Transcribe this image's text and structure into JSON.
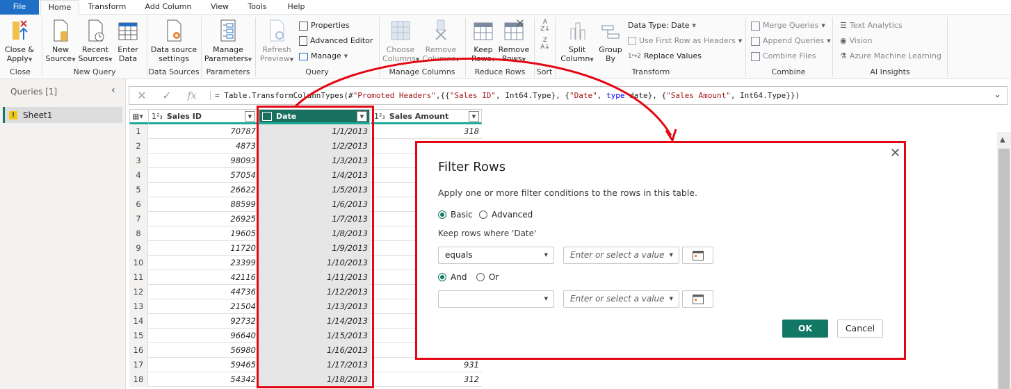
{
  "colors": {
    "accent": "#117865",
    "file_tab": "#1e6fc5",
    "highlight": "#e30613",
    "selected_header": "#1a7060"
  },
  "tabs": [
    "File",
    "Home",
    "Transform",
    "Add Column",
    "View",
    "Tools",
    "Help"
  ],
  "ribbon": {
    "close": {
      "close_apply": [
        "Close &",
        "Apply"
      ],
      "label": "Close"
    },
    "new_query": {
      "new_source": [
        "New",
        "Source"
      ],
      "recent_sources": [
        "Recent",
        "Sources"
      ],
      "enter_data": [
        "Enter",
        "Data"
      ],
      "label": "New Query"
    },
    "data_sources": {
      "settings": [
        "Data source",
        "settings"
      ],
      "label": "Data Sources"
    },
    "parameters": {
      "manage": [
        "Manage",
        "Parameters"
      ],
      "label": "Parameters"
    },
    "query": {
      "refresh": [
        "Refresh",
        "Preview"
      ],
      "properties": "Properties",
      "advanced_editor": "Advanced Editor",
      "manage": "Manage",
      "label": "Query"
    },
    "manage_columns": {
      "choose": [
        "Choose",
        "Columns"
      ],
      "remove": [
        "Remove",
        "Columns"
      ],
      "label": "Manage Columns"
    },
    "reduce_rows": {
      "keep": [
        "Keep",
        "Rows"
      ],
      "remove": [
        "Remove",
        "Rows"
      ],
      "label": "Reduce Rows"
    },
    "sort": {
      "label": "Sort"
    },
    "transform": {
      "split": [
        "Split",
        "Column"
      ],
      "group": [
        "Group",
        "By"
      ],
      "data_type": "Data Type: Date",
      "first_row": "Use First Row as Headers",
      "replace": "Replace Values",
      "label": "Transform"
    },
    "combine": {
      "merge": "Merge Queries",
      "append": "Append Queries",
      "files": "Combine Files",
      "label": "Combine"
    },
    "ai": {
      "text": "Text Analytics",
      "vision": "Vision",
      "azure": "Azure Machine Learning",
      "label": "AI Insights"
    }
  },
  "queries": {
    "title": "Queries [1]",
    "items": [
      {
        "name": "Sheet1",
        "warning": true
      }
    ]
  },
  "formula": {
    "prefix": "= Table.TransformColumnTypes(#",
    "s1": "\"Promoted Headers\"",
    "p2": ",{{",
    "s2": "\"Sales ID\"",
    "p3": ", Int64.Type}, {",
    "s3": "\"Date\"",
    "p4": ", ",
    "kw": "type",
    "p5": " date}, {",
    "s4": "\"Sales Amount\"",
    "p6": ", Int64.Type}})"
  },
  "table": {
    "columns": [
      {
        "name": "Sales ID",
        "type": "1²₃"
      },
      {
        "name": "Date",
        "type": "date"
      },
      {
        "name": "Sales Amount",
        "type": "1²₃"
      }
    ],
    "rows": [
      {
        "n": "1",
        "id": "70787",
        "date": "1/1/2013",
        "amount": "318"
      },
      {
        "n": "2",
        "id": "4873",
        "date": "1/2/2013",
        "amount": ""
      },
      {
        "n": "3",
        "id": "98093",
        "date": "1/3/2013",
        "amount": ""
      },
      {
        "n": "4",
        "id": "57054",
        "date": "1/4/2013",
        "amount": ""
      },
      {
        "n": "5",
        "id": "26622",
        "date": "1/5/2013",
        "amount": ""
      },
      {
        "n": "6",
        "id": "88599",
        "date": "1/6/2013",
        "amount": ""
      },
      {
        "n": "7",
        "id": "26925",
        "date": "1/7/2013",
        "amount": ""
      },
      {
        "n": "8",
        "id": "19605",
        "date": "1/8/2013",
        "amount": ""
      },
      {
        "n": "9",
        "id": "11720",
        "date": "1/9/2013",
        "amount": ""
      },
      {
        "n": "10",
        "id": "23399",
        "date": "1/10/2013",
        "amount": ""
      },
      {
        "n": "11",
        "id": "42116",
        "date": "1/11/2013",
        "amount": ""
      },
      {
        "n": "12",
        "id": "44736",
        "date": "1/12/2013",
        "amount": ""
      },
      {
        "n": "13",
        "id": "21504",
        "date": "1/13/2013",
        "amount": ""
      },
      {
        "n": "14",
        "id": "92732",
        "date": "1/14/2013",
        "amount": ""
      },
      {
        "n": "15",
        "id": "96640",
        "date": "1/15/2013",
        "amount": ""
      },
      {
        "n": "16",
        "id": "56980",
        "date": "1/16/2013",
        "amount": ""
      },
      {
        "n": "17",
        "id": "59465",
        "date": "1/17/2013",
        "amount": "931"
      },
      {
        "n": "18",
        "id": "54342",
        "date": "1/18/2013",
        "amount": "312"
      }
    ]
  },
  "dialog": {
    "title": "Filter Rows",
    "description": "Apply one or more filter conditions to the rows in this table.",
    "mode_basic": "Basic",
    "mode_advanced": "Advanced",
    "mode_selected": "Basic",
    "keep_label": "Keep rows where 'Date'",
    "cond1_operator": "equals",
    "cond1_placeholder": "Enter or select a value",
    "and_label": "And",
    "or_label": "Or",
    "logic_selected": "And",
    "cond2_operator": "",
    "cond2_placeholder": "Enter or select a value",
    "ok": "OK",
    "cancel": "Cancel"
  }
}
